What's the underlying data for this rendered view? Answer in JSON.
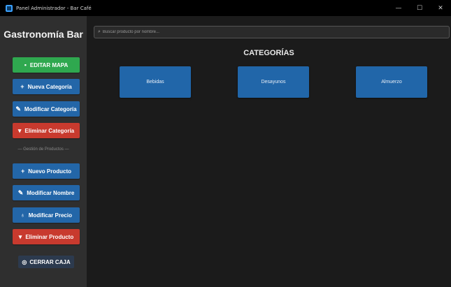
{
  "window": {
    "title": "Panel Administrador - Bar Café",
    "controls": {
      "minimize": "—",
      "maximize": "☐",
      "close": "✕"
    }
  },
  "sidebar": {
    "brand": "Gastronomía Bar",
    "buttons": {
      "editar_mapa": "EDITAR MAPA",
      "nueva_categoria": "Nueva Categoría",
      "modificar_categoria": "Modificar Categoría",
      "eliminar_categoria": "Eliminar Categoría",
      "nuevo_producto": "Nuevo Producto",
      "modificar_nombre": "Modificar Nombre",
      "modificar_precio": "Modificar Precio",
      "eliminar_producto": "Eliminar Producto"
    },
    "section_label": "— Gestión de Productos —",
    "cerrar_caja": "CERRAR CAJA"
  },
  "main": {
    "search": {
      "placeholder": "Buscar producto por nombre...",
      "value": ""
    },
    "title": "CATEGORÍAS",
    "categories": [
      "Bebidas",
      "Desayunos",
      "Almuerzo"
    ]
  },
  "colors": {
    "green": "#2fa84f",
    "blue": "#2366a8",
    "red": "#c83a2e",
    "sidebar_bg": "#2f2f2f",
    "main_bg": "#1b1b1b"
  }
}
